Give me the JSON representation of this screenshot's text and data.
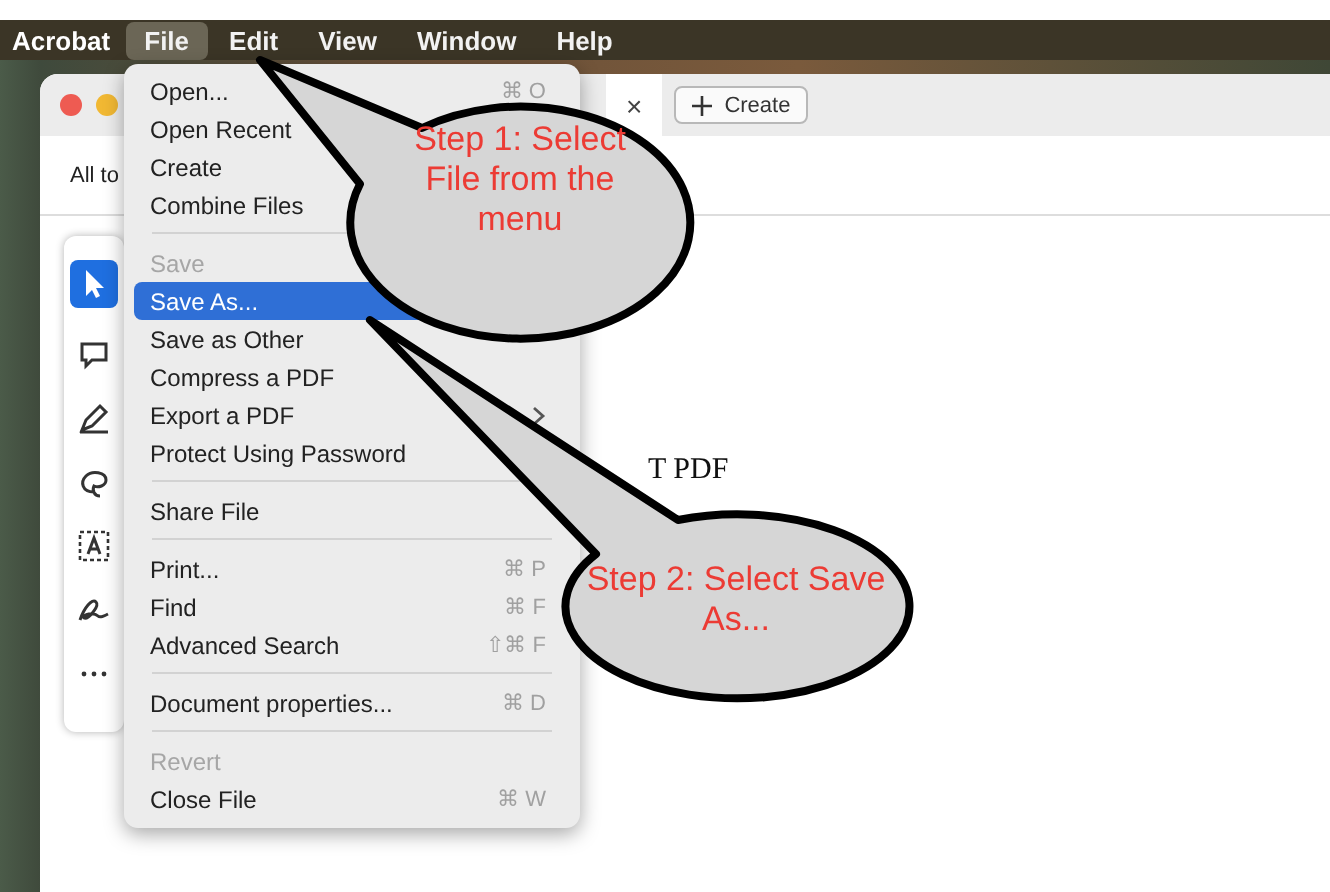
{
  "menu_bar": {
    "app": "Acrobat",
    "items": [
      {
        "label": "File",
        "selected": true
      },
      {
        "label": "Edit",
        "selected": false
      },
      {
        "label": "View",
        "selected": false
      },
      {
        "label": "Window",
        "selected": false
      },
      {
        "label": "Help",
        "selected": false
      }
    ]
  },
  "window": {
    "tab_close": "×",
    "create_button": "Create",
    "toolbar_text": "All to",
    "document_text": "T PDF"
  },
  "file_menu": {
    "items": [
      {
        "kind": "item",
        "label": "Open...",
        "shortcut": "⌘ O",
        "disabled": false,
        "selected": false
      },
      {
        "kind": "item",
        "label": "Open Recent",
        "disabled": false,
        "selected": false
      },
      {
        "kind": "item",
        "label": "Create",
        "disabled": false,
        "selected": false
      },
      {
        "kind": "item",
        "label": "Combine Files",
        "disabled": false,
        "selected": false
      },
      {
        "kind": "separator"
      },
      {
        "kind": "item",
        "label": "Save",
        "disabled": true,
        "selected": false
      },
      {
        "kind": "item",
        "label": "Save As...",
        "disabled": false,
        "selected": true
      },
      {
        "kind": "item",
        "label": "Save as Other",
        "disabled": false,
        "selected": false
      },
      {
        "kind": "item",
        "label": "Compress a PDF",
        "disabled": false,
        "selected": false
      },
      {
        "kind": "submenu",
        "label": "Export a PDF",
        "disabled": false,
        "selected": false
      },
      {
        "kind": "item",
        "label": "Protect Using Password",
        "disabled": false,
        "selected": false
      },
      {
        "kind": "separator"
      },
      {
        "kind": "item",
        "label": "Share File",
        "disabled": false,
        "selected": false
      },
      {
        "kind": "separator"
      },
      {
        "kind": "item",
        "label": "Print...",
        "shortcut": "⌘ P",
        "disabled": false,
        "selected": false
      },
      {
        "kind": "item",
        "label": "Find",
        "shortcut": "⌘ F",
        "disabled": false,
        "selected": false
      },
      {
        "kind": "item",
        "label": "Advanced Search",
        "shortcut": "⇧⌘ F",
        "disabled": false,
        "selected": false
      },
      {
        "kind": "separator"
      },
      {
        "kind": "item",
        "label": "Document properties...",
        "shortcut": "⌘ D",
        "disabled": false,
        "selected": false
      },
      {
        "kind": "separator"
      },
      {
        "kind": "item",
        "label": "Revert",
        "disabled": true,
        "selected": false
      },
      {
        "kind": "item",
        "label": "Close File",
        "shortcut": "⌘ W",
        "disabled": false,
        "selected": false
      }
    ]
  },
  "callouts": [
    {
      "text": "Step 1: Select File from the menu"
    },
    {
      "text": "Step 2: Select Save As..."
    }
  ]
}
